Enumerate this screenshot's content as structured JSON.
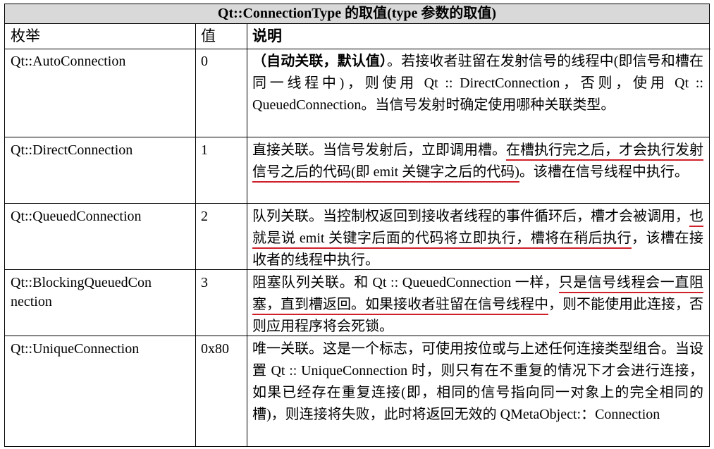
{
  "table": {
    "title": "Qt::ConnectionType 的取值(type 参数的取值)",
    "headers": {
      "enum": "枚举",
      "value": "值",
      "desc": "说明"
    },
    "rows": [
      {
        "enum": "Qt::AutoConnection",
        "value": "0",
        "desc_bold": "（自动关联，默认值）",
        "desc": "。若接收者驻留在发射信号的线程中(即信号和槽在同一线程中)，则使用 Qt :: DirectConnection，否则，使用 Qt :: QueuedConnection。当信号发射时确定使用哪种关联类型。"
      },
      {
        "enum": "Qt::DirectConnection",
        "value": "1",
        "desc_a": "直接关联。当信号发射后，立即调用槽。",
        "desc_u": "在槽执行完之后，才会执行发射信号之后的代码(即 emit 关键字之后的代码)",
        "desc_b": "。该槽在信号线程中执行。"
      },
      {
        "enum": "Qt::QueuedConnection",
        "value": "2",
        "desc_a": "队列关联。当控制权返回到接收者线程的事件循环后，槽才会被调用，",
        "desc_u": "也就是说 emit 关键字后面的代码将立即执行，槽将在稍后执行",
        "desc_b": "，该槽在接收者的线程中执行。"
      },
      {
        "enum_line1": "Qt::BlockingQueuedCon",
        "enum_line2": "nection",
        "value": "3",
        "desc_a": "阻塞队列关联。和 Qt :: QueuedConnection 一样，",
        "desc_u": "只是信号线程会一直阻塞，直到槽返回。如果接收者驻留在信号线程中",
        "desc_b": "，则不能使用此连接，否则应用程序将会死锁。"
      },
      {
        "enum": "Qt::UniqueConnection",
        "value": "0x80",
        "desc": "唯一关联。这是一个标志，可使用按位或与上述任何连接类型组合。当设置 Qt :: UniqueConnection 时，则只有在不重复的情况下才会进行连接，如果已经存在重复连接(即，相同的信号指向同一对象上的完全相同的槽)，则连接将失败，此时将返回无效的 QMetaObject:：Connection"
      }
    ]
  },
  "colors": {
    "title_bg": "#d9d9d9",
    "underline": "#d0202a"
  }
}
